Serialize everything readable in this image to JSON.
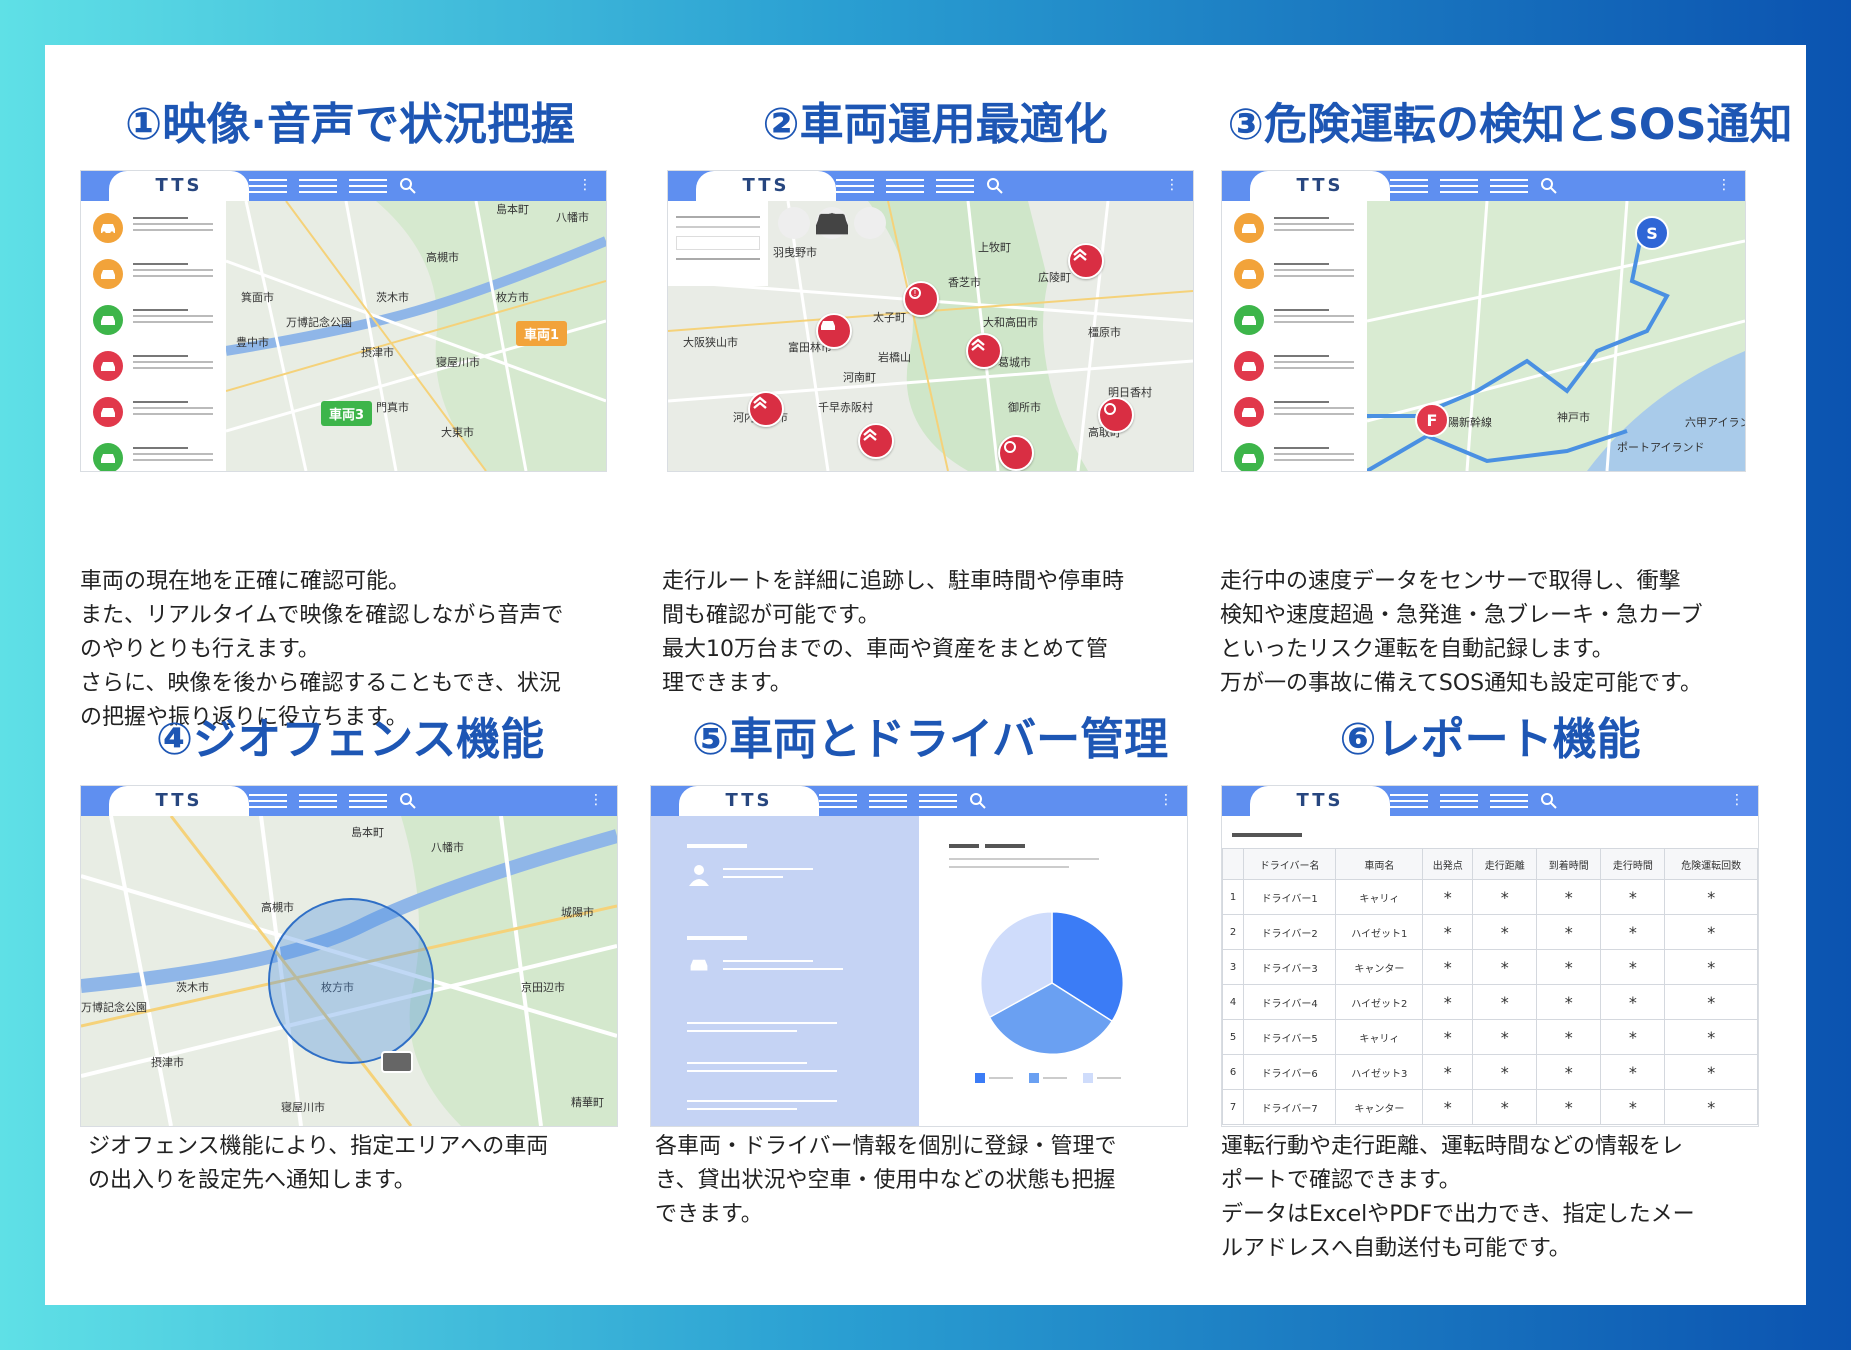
{
  "logo_text": "TTS",
  "features": [
    {
      "title": "①映像·音声で状況把握",
      "desc": "車両の現在地を正確に確認可能。\nまた、リアルタイムで映像を確認しながら音声で\nのやりとりも行えます。\nさらに、映像を後から確認することもでき、状況\nの把握や振り返りに役立ちます。"
    },
    {
      "title": "②車両運用最適化",
      "desc": "走行ルートを詳細に追跡し、駐車時間や停車時\n間も確認が可能です。\n 最大10万台までの、車両や資産をまとめて管\n理できます。"
    },
    {
      "title": "③危険運転の検知とSOS通知",
      "desc": "走行中の速度データをセンサーで取得し、衝撃\n検知や速度超過・急発進・急ブレーキ・急カーブ\nといったリスク運転を自動記録します。\n万が一の事故に備えてSOS通知も設定可能です。"
    },
    {
      "title": "④ジオフェンス機能",
      "desc": "ジオフェンス機能により、指定エリアへの車両\nの出入りを設定先へ通知します。"
    },
    {
      "title": "⑤車両とドライバー管理",
      "desc": "各車両・ドライバー情報を個別に登録・管理で\nき、貸出状況や空車・使用中などの状態も把握\nできます。"
    },
    {
      "title": "⑥レポート機能",
      "desc": "運転行動や走行距離、運転時間などの情報をレ\nポートで確認できます。\nデータはExcelやPDFで出力でき、指定したメー\nルアドレスへ自動送付も可能です。"
    }
  ],
  "map1": {
    "places": [
      "高槻市",
      "枚方市",
      "茨木市",
      "豊中市",
      "寝屋川市",
      "摂津市",
      "箕面市",
      "大東市",
      "八幡市",
      "島本町",
      "万博記念公園",
      "門真市"
    ],
    "tags": [
      "車両1",
      "車両3"
    ]
  },
  "map2": {
    "places": [
      "羽曳野市",
      "上牧町",
      "広陵町",
      "香芝市",
      "太子町",
      "大和高田市",
      "大阪狭山市",
      "富田林市",
      "河南町",
      "橿原市",
      "葛城市",
      "千早赤阪村",
      "御所市",
      "河内長野市",
      "明日香村",
      "高取町",
      "岩橋山"
    ]
  },
  "map3": {
    "places": [
      "神戸市",
      "六甲アイランド",
      "ポートアイランド",
      "山陽新幹線"
    ],
    "pins": [
      "S",
      "F"
    ]
  },
  "map4": {
    "places": [
      "島本町",
      "八幡市",
      "高槻市",
      "枚方市",
      "茨木市",
      "京田辺市",
      "城陽市",
      "万博記念公園",
      "摂津市",
      "寝屋川市",
      "精華町"
    ]
  },
  "report": {
    "headers": [
      "ドライバー名",
      "車両名",
      "出発点",
      "走行距離",
      "到着時間",
      "走行時間",
      "危険運転回数"
    ],
    "rows": [
      {
        "no": "1",
        "driver": "ドライバー1",
        "vehicle": "キャリィ"
      },
      {
        "no": "2",
        "driver": "ドライバー2",
        "vehicle": "ハイゼット1"
      },
      {
        "no": "3",
        "driver": "ドライバー3",
        "vehicle": "キャンター"
      },
      {
        "no": "4",
        "driver": "ドライバー4",
        "vehicle": "ハイゼット2"
      },
      {
        "no": "5",
        "driver": "ドライバー5",
        "vehicle": "キャリィ"
      },
      {
        "no": "6",
        "driver": "ドライバー6",
        "vehicle": "ハイゼット3"
      },
      {
        "no": "7",
        "driver": "ドライバー7",
        "vehicle": "キャンター"
      }
    ],
    "cell": "*"
  },
  "chart_data": {
    "type": "pie",
    "values": [
      34,
      33,
      33
    ],
    "colors": [
      "#3b7cf6",
      "#6aa0f2",
      "#cfdcfb"
    ]
  },
  "colors": {
    "title": "#1d56b4",
    "topbar": "#5f8ff0",
    "orange": "#f2a33a",
    "green": "#3db54a",
    "red": "#e1384b"
  }
}
